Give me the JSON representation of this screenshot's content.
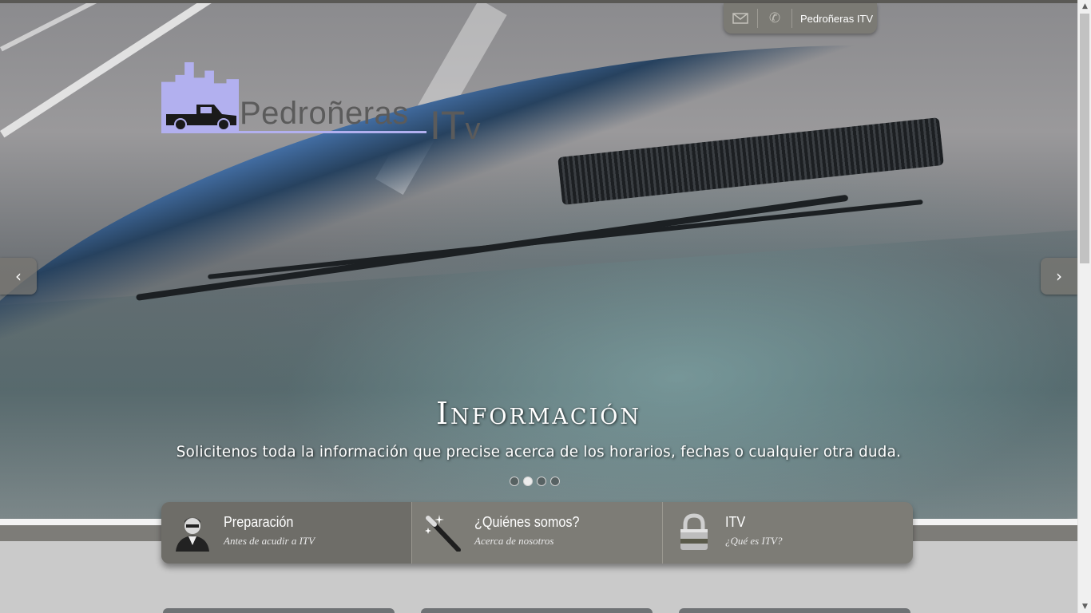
{
  "site": {
    "logo_text": "Pedroñeras",
    "logo_itv": "IT",
    "logo_itv_v": "v",
    "brand_color": "#b2b0ef"
  },
  "topbar": {
    "mail_icon": "envelope-icon",
    "phone_icon": "phone-icon",
    "label": "Pedroñeras ITV"
  },
  "slider": {
    "title": "Información",
    "text": "Solicitenos toda la información que precise acerca de los horarios, fechas o cualquier otra duda.",
    "slides": 4,
    "active_slide": 2
  },
  "menu": [
    {
      "title": "Preparación",
      "subtitle": "Antes de acudir a ITV",
      "icon": "businessman-icon"
    },
    {
      "title": "¿Quiénes somos?",
      "subtitle": "Acerca de nosotros",
      "icon": "magic-wand-icon"
    },
    {
      "title": "ITV",
      "subtitle": "¿Qué es ITV?",
      "icon": "padlock-icon"
    }
  ]
}
